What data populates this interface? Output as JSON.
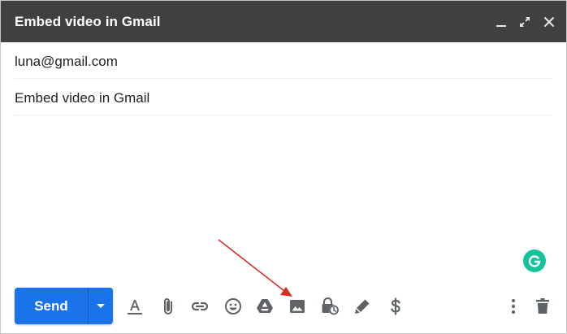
{
  "window": {
    "title": "Embed video in Gmail",
    "buttons": [
      "minimize",
      "fullscreen",
      "close"
    ]
  },
  "fields": {
    "to": "luna@gmail.com",
    "subject": "Embed video in Gmail"
  },
  "toolbar": {
    "send_label": "Send",
    "icons": [
      "formatting-options-icon",
      "attach-files-icon",
      "insert-link-icon",
      "insert-emoji-icon",
      "google-drive-icon",
      "insert-photo-icon",
      "confidential-mode-icon",
      "insert-signature-icon",
      "send-money-icon",
      "more-options-icon",
      "discard-draft-icon"
    ]
  },
  "colors": {
    "titlebar": "#404040",
    "send_button": "#1a73e8",
    "icon": "#5f6368",
    "grammarly": "#15c39a",
    "annotation_arrow": "#d93025"
  }
}
